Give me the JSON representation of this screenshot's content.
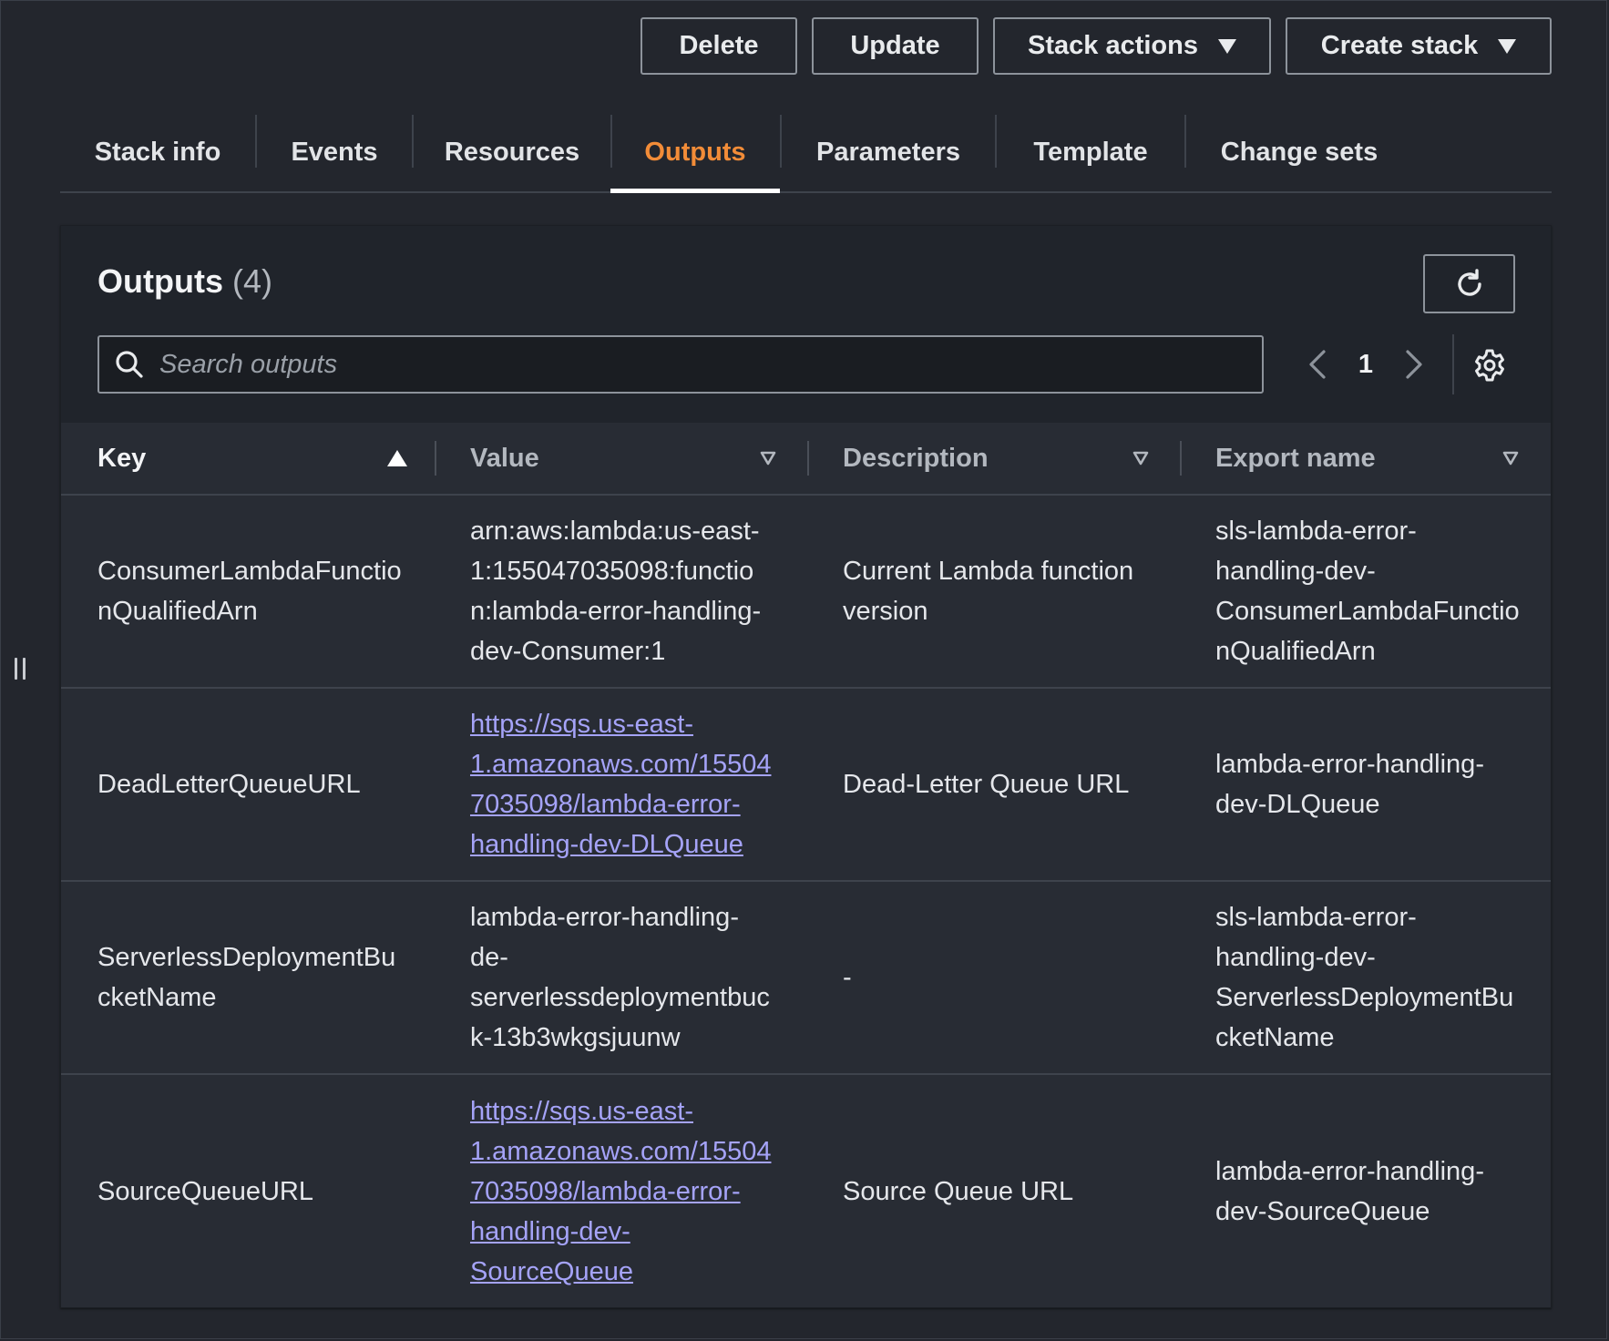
{
  "toolbar": {
    "delete_label": "Delete",
    "update_label": "Update",
    "stack_actions_label": "Stack actions",
    "create_stack_label": "Create stack"
  },
  "tabs": [
    {
      "label": "Stack info"
    },
    {
      "label": "Events"
    },
    {
      "label": "Resources"
    },
    {
      "label": "Outputs",
      "active": true
    },
    {
      "label": "Parameters"
    },
    {
      "label": "Template"
    },
    {
      "label": "Change sets"
    }
  ],
  "panel": {
    "title": "Outputs",
    "count": "(4)",
    "search_placeholder": "Search outputs",
    "page": "1"
  },
  "columns": {
    "key": "Key",
    "value": "Value",
    "description": "Description",
    "export_name": "Export name"
  },
  "rows": [
    {
      "key": "ConsumerLambdaFunctio\nnQualifiedArn",
      "value": "arn:aws:lambda:us-east-\n1:155047035098:functio\nn:lambda-error-handling-\ndev-Consumer:1",
      "value_is_link": false,
      "description": "Current Lambda function\nversion",
      "export_name": "sls-lambda-error-\nhandling-dev-\nConsumerLambdaFunctio\nnQualifiedArn"
    },
    {
      "key": "DeadLetterQueueURL",
      "value": "https://sqs.us-east-\n1.amazonaws.com/15504\n7035098/lambda-error-\nhandling-dev-DLQueue",
      "value_is_link": true,
      "description": "Dead-Letter Queue URL",
      "export_name": "lambda-error-handling-\ndev-DLQueue"
    },
    {
      "key": "ServerlessDeploymentBu\ncketName",
      "value": "lambda-error-handling-\nde-\nserverlessdeploymentbuc\nk-13b3wkgsjuunw",
      "value_is_link": false,
      "description": "-",
      "export_name": "sls-lambda-error-\nhandling-dev-\nServerlessDeploymentBu\ncketName"
    },
    {
      "key": "SourceQueueURL",
      "value": "https://sqs.us-east-\n1.amazonaws.com/15504\n7035098/lambda-error-\nhandling-dev-\nSourceQueue",
      "value_is_link": true,
      "description": "Source Queue URL",
      "export_name": "lambda-error-handling-\ndev-SourceQueue"
    }
  ],
  "colors": {
    "background": "#23262d",
    "panel": "#282c34",
    "accent_tab": "#f28c38",
    "link": "#a5a3f8"
  },
  "icons": {
    "search": "search-icon",
    "refresh": "refresh-icon",
    "settings": "gear-icon",
    "prev": "chevron-left-icon",
    "next": "chevron-right-icon"
  }
}
